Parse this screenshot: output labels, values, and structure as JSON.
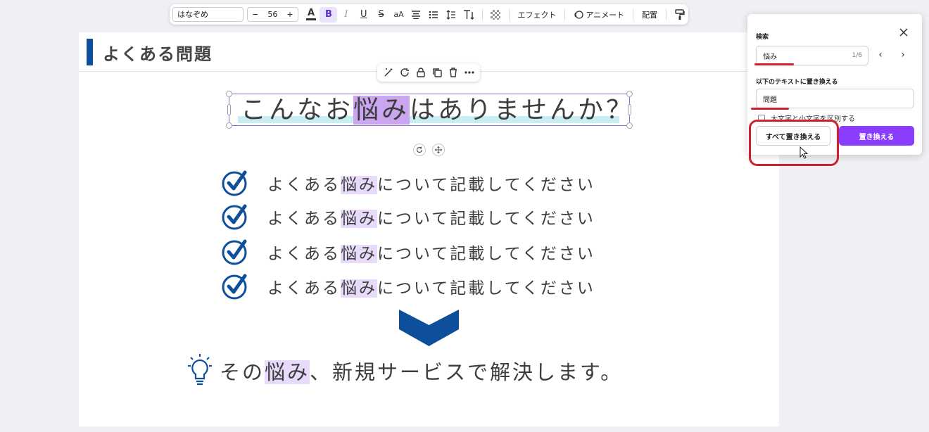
{
  "toolbar": {
    "font_name": "はなぞめ",
    "font_size": "56",
    "minus": "−",
    "plus": "+",
    "bold": "B",
    "italic": "I",
    "underline": "U",
    "strike": "S",
    "case": "aA",
    "effects_label": "エフェクト",
    "animate_label": "アニメート",
    "position_label": "配置"
  },
  "slide": {
    "header_title": "よくある問題",
    "title": {
      "part1": "こんなお",
      "highlight": "悩み",
      "part2": "はありませんか？"
    },
    "checklist": [
      {
        "before": "よくある",
        "highlight": "悩み",
        "after": "について記載してください"
      },
      {
        "before": "よくある",
        "highlight": "悩み",
        "after": "について記載してください"
      },
      {
        "before": "よくある",
        "highlight": "悩み",
        "after": "について記載してください"
      },
      {
        "before": "よくある",
        "highlight": "悩み",
        "after": "について記載してください"
      }
    ],
    "bottom": {
      "before": "その",
      "highlight": "悩み",
      "after": "、新規サービスで解決します。"
    }
  },
  "panel": {
    "search_label": "検索",
    "search_value": "悩み",
    "match_count": "1/6",
    "prev": "‹",
    "next": "›",
    "replace_label": "以下のテキストに置き換える",
    "replace_value": "問題",
    "case_label": "大文字と小文字を区別する",
    "replace_all_label": "すべて置き換える",
    "replace_label_btn": "置き換える"
  },
  "colors": {
    "accent_purple": "#8b3dff",
    "brand_blue": "#0e4f9c",
    "annotation_red": "#cf1f2e",
    "highlight_strong": "#c9a6ef",
    "highlight_soft": "#e7dafa",
    "title_underline": "#c8eef3"
  }
}
